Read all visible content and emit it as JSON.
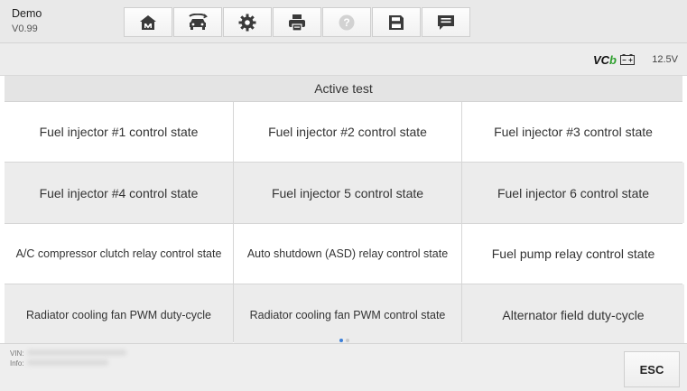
{
  "app": {
    "title": "Demo",
    "version": "V0.99"
  },
  "toolbar": {
    "buttons": [
      {
        "icon": "home-icon"
      },
      {
        "icon": "vehicle-swap-icon"
      },
      {
        "icon": "gear-icon"
      },
      {
        "icon": "printer-icon"
      },
      {
        "icon": "help-icon",
        "disabled": true
      },
      {
        "icon": "save-icon"
      },
      {
        "icon": "data-logging-icon"
      }
    ]
  },
  "status": {
    "vci_text": "VC",
    "vci_suffix": "b",
    "voltage": "12.5V",
    "vci_color": "#2c9f2c"
  },
  "section": {
    "title": "Active test"
  },
  "tests": [
    "Fuel injector #1 control state",
    "Fuel injector #2 control state",
    "Fuel injector #3 control state",
    "Fuel injector #4 control state",
    "Fuel injector 5 control state",
    "Fuel injector 6 control state",
    "A/C compressor clutch relay control state",
    "Auto shutdown (ASD) relay control state",
    "Fuel pump relay control state",
    "Radiator cooling fan PWM duty-cycle",
    "Radiator cooling fan PWM control state",
    "Alternator field duty-cycle"
  ],
  "pagination": {
    "page": 1,
    "pages": 2
  },
  "footer": {
    "vin_label": "VIN:",
    "info_label": "Info:",
    "esc_label": "ESC"
  }
}
